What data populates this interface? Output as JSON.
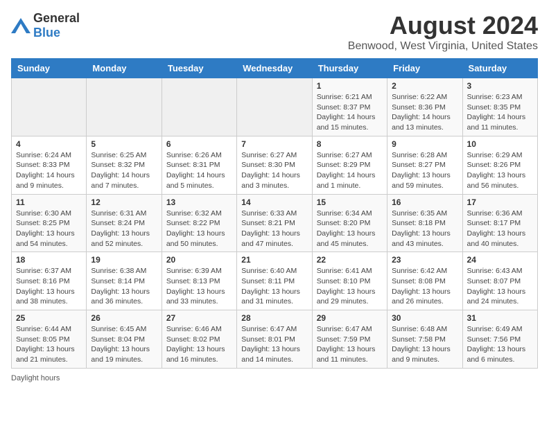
{
  "logo": {
    "general": "General",
    "blue": "Blue"
  },
  "header": {
    "title": "August 2024",
    "subtitle": "Benwood, West Virginia, United States"
  },
  "weekdays": [
    "Sunday",
    "Monday",
    "Tuesday",
    "Wednesday",
    "Thursday",
    "Friday",
    "Saturday"
  ],
  "weeks": [
    [
      {
        "day": "",
        "info": ""
      },
      {
        "day": "",
        "info": ""
      },
      {
        "day": "",
        "info": ""
      },
      {
        "day": "",
        "info": ""
      },
      {
        "day": "1",
        "info": "Sunrise: 6:21 AM\nSunset: 8:37 PM\nDaylight: 14 hours and 15 minutes."
      },
      {
        "day": "2",
        "info": "Sunrise: 6:22 AM\nSunset: 8:36 PM\nDaylight: 14 hours and 13 minutes."
      },
      {
        "day": "3",
        "info": "Sunrise: 6:23 AM\nSunset: 8:35 PM\nDaylight: 14 hours and 11 minutes."
      }
    ],
    [
      {
        "day": "4",
        "info": "Sunrise: 6:24 AM\nSunset: 8:33 PM\nDaylight: 14 hours and 9 minutes."
      },
      {
        "day": "5",
        "info": "Sunrise: 6:25 AM\nSunset: 8:32 PM\nDaylight: 14 hours and 7 minutes."
      },
      {
        "day": "6",
        "info": "Sunrise: 6:26 AM\nSunset: 8:31 PM\nDaylight: 14 hours and 5 minutes."
      },
      {
        "day": "7",
        "info": "Sunrise: 6:27 AM\nSunset: 8:30 PM\nDaylight: 14 hours and 3 minutes."
      },
      {
        "day": "8",
        "info": "Sunrise: 6:27 AM\nSunset: 8:29 PM\nDaylight: 14 hours and 1 minute."
      },
      {
        "day": "9",
        "info": "Sunrise: 6:28 AM\nSunset: 8:27 PM\nDaylight: 13 hours and 59 minutes."
      },
      {
        "day": "10",
        "info": "Sunrise: 6:29 AM\nSunset: 8:26 PM\nDaylight: 13 hours and 56 minutes."
      }
    ],
    [
      {
        "day": "11",
        "info": "Sunrise: 6:30 AM\nSunset: 8:25 PM\nDaylight: 13 hours and 54 minutes."
      },
      {
        "day": "12",
        "info": "Sunrise: 6:31 AM\nSunset: 8:24 PM\nDaylight: 13 hours and 52 minutes."
      },
      {
        "day": "13",
        "info": "Sunrise: 6:32 AM\nSunset: 8:22 PM\nDaylight: 13 hours and 50 minutes."
      },
      {
        "day": "14",
        "info": "Sunrise: 6:33 AM\nSunset: 8:21 PM\nDaylight: 13 hours and 47 minutes."
      },
      {
        "day": "15",
        "info": "Sunrise: 6:34 AM\nSunset: 8:20 PM\nDaylight: 13 hours and 45 minutes."
      },
      {
        "day": "16",
        "info": "Sunrise: 6:35 AM\nSunset: 8:18 PM\nDaylight: 13 hours and 43 minutes."
      },
      {
        "day": "17",
        "info": "Sunrise: 6:36 AM\nSunset: 8:17 PM\nDaylight: 13 hours and 40 minutes."
      }
    ],
    [
      {
        "day": "18",
        "info": "Sunrise: 6:37 AM\nSunset: 8:16 PM\nDaylight: 13 hours and 38 minutes."
      },
      {
        "day": "19",
        "info": "Sunrise: 6:38 AM\nSunset: 8:14 PM\nDaylight: 13 hours and 36 minutes."
      },
      {
        "day": "20",
        "info": "Sunrise: 6:39 AM\nSunset: 8:13 PM\nDaylight: 13 hours and 33 minutes."
      },
      {
        "day": "21",
        "info": "Sunrise: 6:40 AM\nSunset: 8:11 PM\nDaylight: 13 hours and 31 minutes."
      },
      {
        "day": "22",
        "info": "Sunrise: 6:41 AM\nSunset: 8:10 PM\nDaylight: 13 hours and 29 minutes."
      },
      {
        "day": "23",
        "info": "Sunrise: 6:42 AM\nSunset: 8:08 PM\nDaylight: 13 hours and 26 minutes."
      },
      {
        "day": "24",
        "info": "Sunrise: 6:43 AM\nSunset: 8:07 PM\nDaylight: 13 hours and 24 minutes."
      }
    ],
    [
      {
        "day": "25",
        "info": "Sunrise: 6:44 AM\nSunset: 8:05 PM\nDaylight: 13 hours and 21 minutes."
      },
      {
        "day": "26",
        "info": "Sunrise: 6:45 AM\nSunset: 8:04 PM\nDaylight: 13 hours and 19 minutes."
      },
      {
        "day": "27",
        "info": "Sunrise: 6:46 AM\nSunset: 8:02 PM\nDaylight: 13 hours and 16 minutes."
      },
      {
        "day": "28",
        "info": "Sunrise: 6:47 AM\nSunset: 8:01 PM\nDaylight: 13 hours and 14 minutes."
      },
      {
        "day": "29",
        "info": "Sunrise: 6:47 AM\nSunset: 7:59 PM\nDaylight: 13 hours and 11 minutes."
      },
      {
        "day": "30",
        "info": "Sunrise: 6:48 AM\nSunset: 7:58 PM\nDaylight: 13 hours and 9 minutes."
      },
      {
        "day": "31",
        "info": "Sunrise: 6:49 AM\nSunset: 7:56 PM\nDaylight: 13 hours and 6 minutes."
      }
    ]
  ],
  "footer": {
    "text": "Daylight hours"
  }
}
